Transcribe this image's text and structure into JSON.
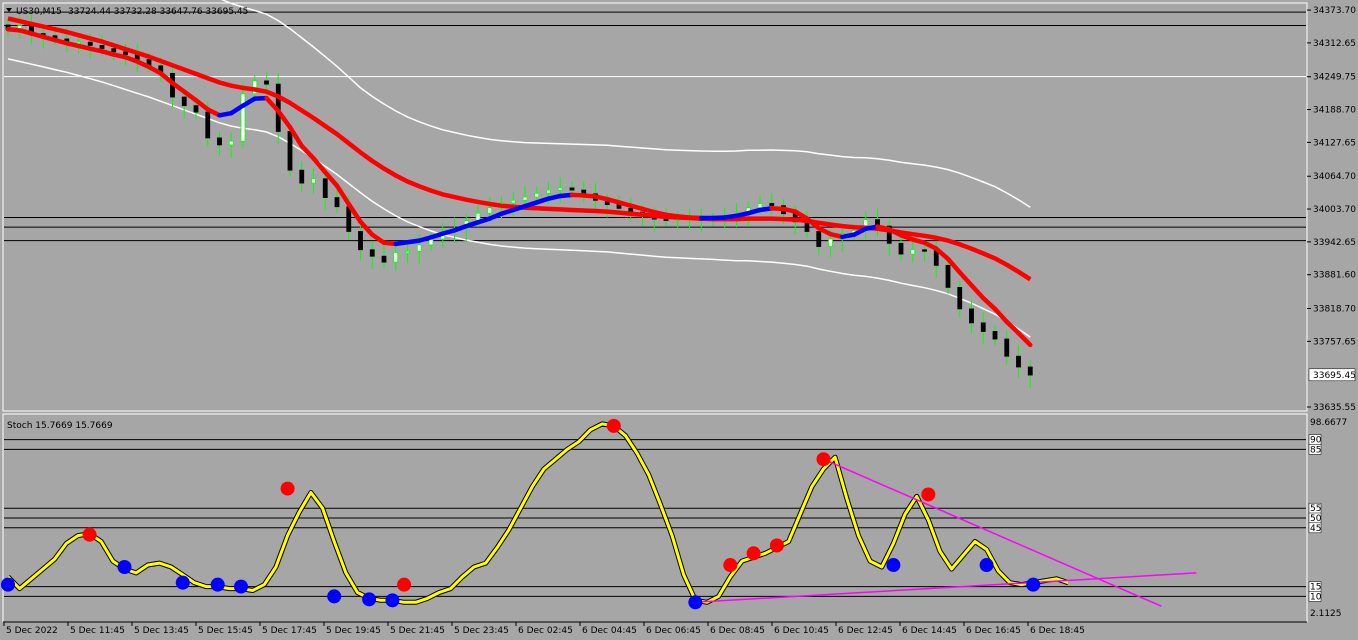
{
  "header": {
    "symbol_label": "US30,M15",
    "ohlc_text": "33724.44 33732.28 33647.76 33695.45"
  },
  "colors": {
    "background": "#a6a6a6",
    "ma_fast_up": "#0000ff",
    "ma_fast_down": "#ff0000",
    "ma_slow": "#ff0000",
    "envelope": "#ffffff",
    "candle_bull_wick": "#00ff00",
    "candle_bear": "#000000",
    "stoch_line": "#ffff00",
    "stoch_peak": "#ff0000",
    "stoch_trough": "#0000ff",
    "trendline": "#ff00ff",
    "level_line": "#000000"
  },
  "chart_data": [
    {
      "type": "line",
      "title": "US30,M15",
      "y_ticks": [
        "34373.70",
        "34312.65",
        "34249.75",
        "34188.70",
        "34127.65",
        "34064.70",
        "34003.70",
        "33942.65",
        "33881.60",
        "33818.70",
        "33757.65",
        "33695.45",
        "33635.55"
      ],
      "ylim": [
        33630,
        34385
      ],
      "current_price": 33695.45,
      "horizontal_levels": [
        34370,
        34345,
        34250,
        33988,
        33970,
        33945
      ],
      "x_labels": [
        "5 Dec 2022",
        "5 Dec 11:45",
        "5 Dec 13:45",
        "5 Dec 15:45",
        "5 Dec 17:45",
        "5 Dec 19:45",
        "5 Dec 21:45",
        "5 Dec 23:45",
        "6 Dec 02:45",
        "6 Dec 04:45",
        "6 Dec 06:45",
        "6 Dec 08:45",
        "6 Dec 10:45",
        "6 Dec 12:45",
        "6 Dec 14:45",
        "6 Dec 16:45",
        "6 Dec 18:45"
      ],
      "close_series": [
        34338,
        34345,
        34330,
        34326,
        34320,
        34312,
        34314,
        34308,
        34302,
        34296,
        34291,
        34282,
        34270,
        34256,
        34212,
        34196,
        34184,
        34136,
        34123,
        34130,
        34218,
        34242,
        34236,
        34148,
        34076,
        34052,
        34060,
        34025,
        34008,
        33962,
        33928,
        33916,
        33905,
        33923,
        33925,
        33937,
        33948,
        33962,
        33968,
        33982,
        33996,
        34006,
        34015,
        34020,
        34026,
        34033,
        34039,
        34043,
        34039,
        34032,
        34020,
        34012,
        34005,
        33998,
        33991,
        33985,
        33983,
        33988,
        33985,
        33984,
        33985,
        33990,
        33995,
        34006,
        34014,
        34010,
        33995,
        33980,
        33962,
        33934,
        33948,
        33958,
        33964,
        33984,
        33972,
        33940,
        33920,
        33928,
        33926,
        33899,
        33858,
        33818,
        33792,
        33776,
        33762,
        33730,
        33710,
        33695
      ],
      "ma_fast": [
        34338,
        34336,
        34330,
        34324,
        34318,
        34312,
        34307,
        34302,
        34297,
        34291,
        34286,
        34278,
        34268,
        34256,
        34238,
        34222,
        34206,
        34189,
        34178,
        34182,
        34196,
        34209,
        34210,
        34186,
        34156,
        34121,
        34098,
        34072,
        34047,
        34013,
        33980,
        33956,
        33941,
        33939,
        33942,
        33945,
        33951,
        33958,
        33964,
        33972,
        33979,
        33986,
        33995,
        34002,
        34009,
        34016,
        34023,
        34028,
        34030,
        34029,
        34027,
        34022,
        34016,
        34010,
        34004,
        33998,
        33993,
        33990,
        33988,
        33987,
        33987,
        33988,
        33991,
        33996,
        34002,
        34005,
        34004,
        33999,
        33986,
        33968,
        33957,
        33952,
        33956,
        33967,
        33971,
        33966,
        33955,
        33947,
        33941,
        33930,
        33911,
        33886,
        33862,
        33838,
        33818,
        33794,
        33773,
        33751
      ],
      "ma_slow": [
        34358,
        34353,
        34348,
        34343,
        34338,
        34333,
        34327,
        34321,
        34315,
        34308,
        34301,
        34294,
        34287,
        34279,
        34271,
        34263,
        34255,
        34247,
        34239,
        34233,
        34229,
        34226,
        34222,
        34213,
        34201,
        34187,
        34173,
        34158,
        34143,
        34126,
        34109,
        34093,
        34079,
        34066,
        34055,
        34046,
        34038,
        34031,
        34026,
        34021,
        34017,
        34013,
        34010,
        34008,
        34006,
        34005,
        34004,
        34003,
        34002,
        34001,
        34000,
        33999,
        33997,
        33995,
        33993,
        33991,
        33989,
        33988,
        33987,
        33986,
        33985,
        33985,
        33985,
        33986,
        33986,
        33986,
        33985,
        33984,
        33982,
        33978,
        33975,
        33972,
        33970,
        33969,
        33967,
        33964,
        33960,
        33957,
        33954,
        33950,
        33945,
        33938,
        33930,
        33921,
        33912,
        33900,
        33887,
        33873
      ],
      "env_upper_y": [
        30,
        20,
        10,
        5,
        0,
        -2,
        -4,
        -6,
        -3,
        -5,
        -1,
        -2,
        -4,
        -7,
        -9,
        -11,
        -8,
        -10,
        -12,
        -14,
        -16,
        -19,
        -16,
        -13,
        -15,
        -18,
        -21,
        -24,
        -27,
        -29,
        -32,
        -35,
        -37,
        -40,
        -42,
        -44,
        -46,
        -48,
        -50,
        -51,
        -52,
        -53,
        -54,
        -55,
        -56,
        -56,
        -57,
        -58,
        -59,
        -59,
        -60,
        -61,
        -61,
        -62,
        -62,
        -63,
        -63,
        -64,
        -64,
        -65,
        -65,
        -66,
        -66,
        -66,
        -66,
        -67,
        -68,
        -69,
        -71,
        -73,
        -74,
        -75,
        -76,
        -77,
        -78,
        -79,
        -80,
        -81,
        -82,
        -83,
        -84,
        -85,
        -86,
        -87,
        -88,
        -89,
        -90,
        -91
      ],
      "env_lower_y": [
        -12,
        -18,
        -24,
        -30,
        -35,
        -40,
        -44,
        -47,
        -50,
        -52,
        -55,
        -58,
        -62,
        -65,
        -68,
        -71,
        -73,
        -74,
        -75,
        -77,
        -78,
        -80,
        -81,
        -83,
        -84,
        -85,
        -86,
        -87,
        -88,
        -89,
        -90,
        -91,
        -91,
        -92,
        -92,
        -93,
        -93,
        -93,
        -94,
        -94,
        -94,
        -95,
        -95,
        -95,
        -95,
        -95,
        -96,
        -96,
        -96,
        -96,
        -96,
        -96,
        -97,
        -97,
        -97,
        -97,
        -97,
        -97,
        -98,
        -98,
        -98,
        -98,
        -98,
        -98,
        -99,
        -99,
        -99,
        -99,
        -100,
        -100,
        -100,
        -101,
        -101,
        -102,
        -102,
        -103,
        -103,
        -104,
        -104,
        -105,
        -105,
        -106,
        -106,
        -107,
        -107,
        -108,
        -108,
        -109
      ]
    },
    {
      "type": "line",
      "title": "Stoch 15.7669 15.7669",
      "ylim": [
        0,
        100
      ],
      "y_ticks": [
        "98.6677",
        "90",
        "85",
        "55",
        "50",
        "45",
        "15",
        "10",
        "2.1125"
      ],
      "levels": [
        90,
        85,
        55,
        50,
        45,
        15,
        10
      ],
      "values": [
        20,
        14,
        19,
        24,
        29,
        37,
        41,
        42,
        38,
        28,
        24,
        22,
        26,
        27,
        25,
        21,
        17,
        15,
        15,
        14,
        14,
        13,
        16,
        25,
        41,
        53,
        63,
        55,
        38,
        22,
        12,
        9,
        8,
        8,
        7,
        7,
        9,
        12,
        14,
        20,
        25,
        27,
        35,
        44,
        55,
        66,
        75,
        80,
        85,
        89,
        95,
        98,
        97,
        92,
        83,
        72,
        57,
        41,
        21,
        8,
        7,
        10,
        20,
        28,
        30,
        32,
        35,
        38,
        52,
        66,
        75,
        81,
        60,
        41,
        28,
        25,
        37,
        52,
        61,
        49,
        33,
        24,
        31,
        38,
        34,
        23,
        17,
        16,
        17,
        18,
        19,
        17
      ],
      "peak_markers": [
        [
          7,
          41.5
        ],
        [
          24,
          65
        ],
        [
          34,
          16
        ],
        [
          52,
          97
        ],
        [
          62,
          26
        ],
        [
          64,
          32
        ],
        [
          66,
          36
        ],
        [
          70,
          80
        ],
        [
          79,
          62
        ]
      ],
      "trough_markers": [
        [
          0,
          16
        ],
        [
          10,
          25
        ],
        [
          15,
          17
        ],
        [
          18,
          16
        ],
        [
          20,
          15
        ],
        [
          28,
          10
        ],
        [
          31,
          8.5
        ],
        [
          33,
          8
        ],
        [
          59,
          7
        ],
        [
          76,
          26
        ],
        [
          84,
          26
        ],
        [
          88,
          16
        ]
      ],
      "trendlines": [
        {
          "from": [
            70,
            80
          ],
          "to": [
            99,
            5
          ]
        },
        {
          "from": [
            59,
            7
          ],
          "to": [
            102,
            22
          ]
        }
      ]
    }
  ]
}
